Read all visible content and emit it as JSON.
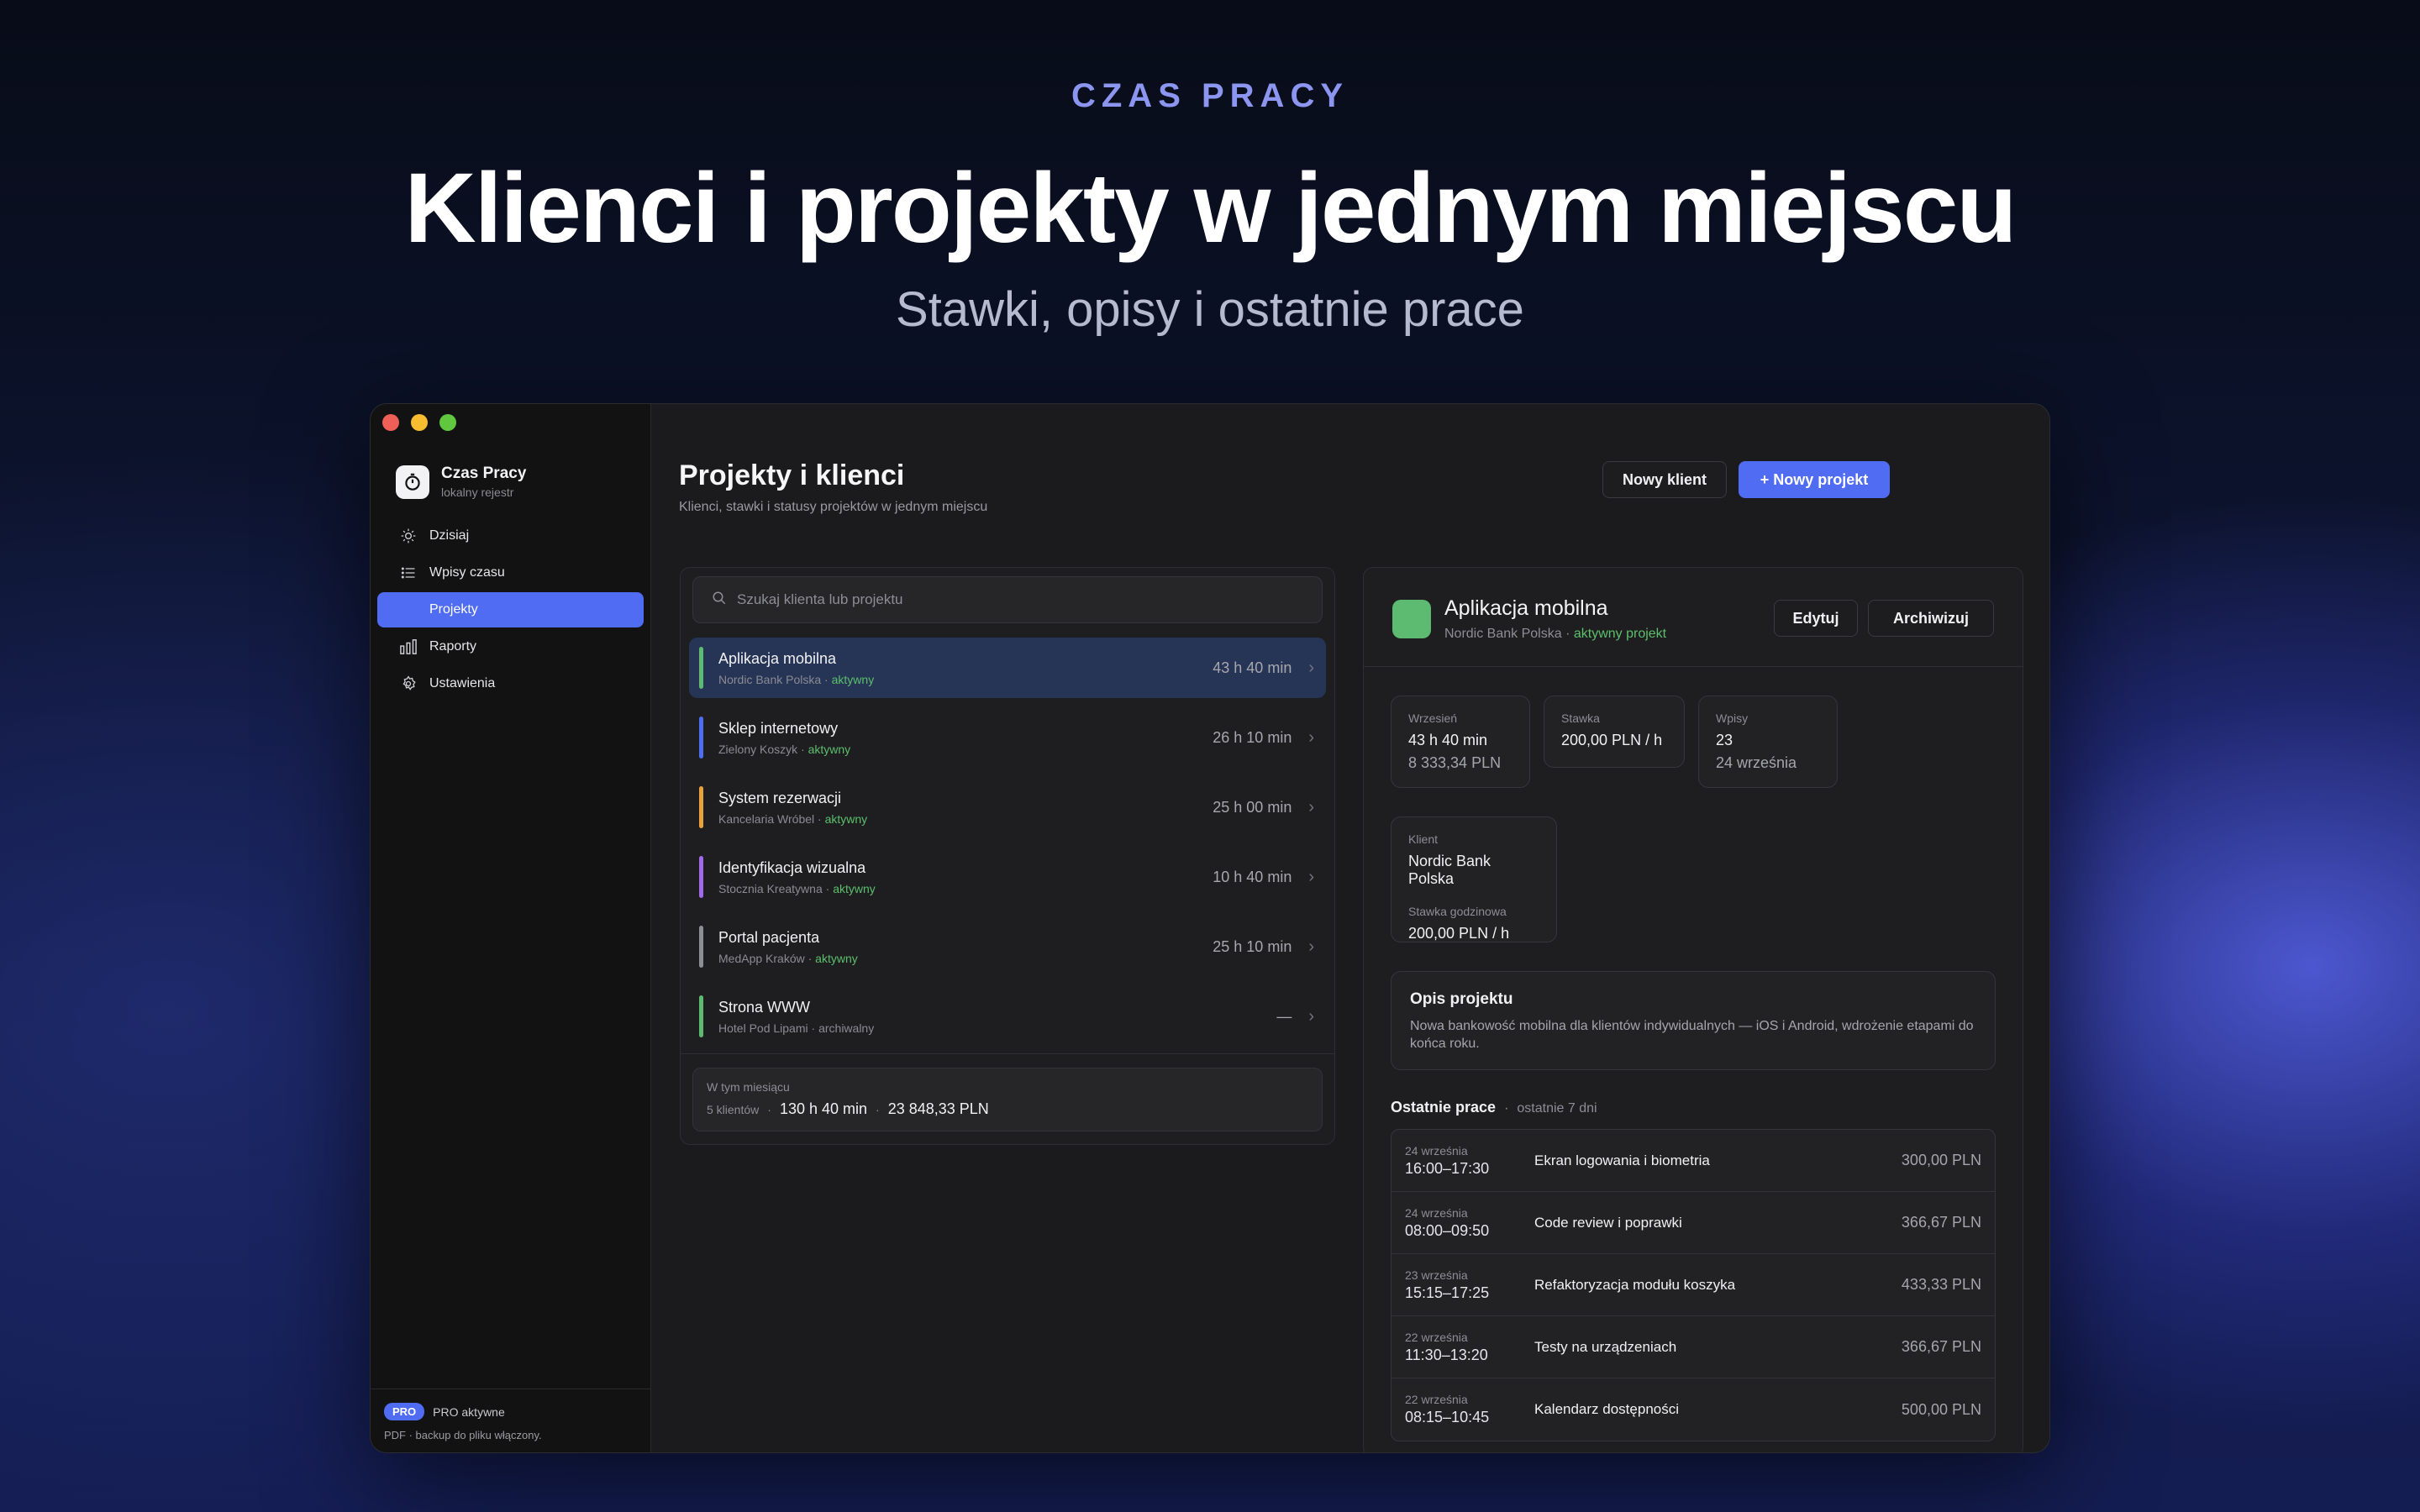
{
  "hero": {
    "eyebrow": "CZAS PRACY",
    "headline": "Klienci i projekty w jednym miejscu",
    "subhead": "Stawki, opisy i ostatnie prace"
  },
  "sidebar": {
    "brand_title": "Czas Pracy",
    "brand_sub": "lokalny rejestr",
    "items": [
      {
        "label": "Dzisiaj",
        "icon": "sun-icon"
      },
      {
        "label": "Wpisy czasu",
        "icon": "list-icon"
      },
      {
        "label": "Projekty",
        "icon": "folder-icon",
        "active": true
      },
      {
        "label": "Raporty",
        "icon": "bar-chart-icon"
      },
      {
        "label": "Ustawienia",
        "icon": "gear-icon"
      }
    ],
    "pro_badge": "PRO",
    "pro_label": "PRO aktywne",
    "pro_note": "PDF · backup do pliku włączony."
  },
  "header": {
    "title": "Projekty i klienci",
    "subtitle": "Klienci, stawki i statusy projektów w jednym miejscu",
    "new_client": "Nowy klient",
    "new_project": "+ Nowy projekt"
  },
  "search": {
    "placeholder": "Szukaj klienta lub projektu"
  },
  "projects": [
    {
      "name": "Aplikacja mobilna",
      "client": "Nordic Bank Polska",
      "status": "aktywny",
      "hours": "43 h 40 min",
      "color": "#5cbb70",
      "selected": true
    },
    {
      "name": "Sklep internetowy",
      "client": "Zielony Koszyk",
      "status": "aktywny",
      "hours": "26 h 10 min",
      "color": "#4f6cf2"
    },
    {
      "name": "System rezerwacji",
      "client": "Kancelaria Wróbel",
      "status": "aktywny",
      "hours": "25 h 00 min",
      "color": "#e8a23c"
    },
    {
      "name": "Identyfikacja wizualna",
      "client": "Stocznia Kreatywna",
      "status": "aktywny",
      "hours": "10 h 40 min",
      "color": "#a06ae8"
    },
    {
      "name": "Portal pacjenta",
      "client": "MedApp Kraków",
      "status": "aktywny",
      "hours": "25 h 10 min",
      "color": "#8e8e96"
    },
    {
      "name": "Strona WWW",
      "client": "Hotel Pod Lipami",
      "status": "archiwalny",
      "hours": "—",
      "color": "#5cbb70"
    }
  ],
  "summary": {
    "label": "W tym miesiącu",
    "clients": "5 klientów",
    "sep": "·",
    "hours": "130 h 40 min",
    "sep2": "·",
    "amount": "23 848,33 PLN"
  },
  "detail": {
    "title": "Aplikacja mobilna",
    "client": "Nordic Bank Polska",
    "status": "aktywny projekt",
    "edit": "Edytuj",
    "archive": "Archiwizuj",
    "month_label": "Wrzesień",
    "month_hours": "43 h 40 min",
    "month_amount": "8 333,34 PLN",
    "rate_label": "Stawka",
    "rate_value": "200,00 PLN / h",
    "entries_label": "Wpisy",
    "entries_count": "23",
    "entries_last": "24 września",
    "client_label": "Klient",
    "client_value": "Nordic Bank Polska",
    "hourly_label": "Stawka godzinowa",
    "hourly_value": "200,00 PLN / h",
    "desc_title": "Opis projektu",
    "desc_text": "Nowa bankowość mobilna dla klientów indywidualnych — iOS i Android, wdrożenie etapami do końca roku.",
    "recent_title": "Ostatnie prace",
    "recent_sep": "·",
    "recent_range": "ostatnie 7 dni",
    "recent": [
      {
        "date": "24 września",
        "time": "16:00–17:30",
        "task": "Ekran logowania i biometria",
        "amount": "300,00 PLN"
      },
      {
        "date": "24 września",
        "time": "08:00–09:50",
        "task": "Code review i poprawki",
        "amount": "366,67 PLN"
      },
      {
        "date": "23 września",
        "time": "15:15–17:25",
        "task": "Refaktoryzacja modułu koszyka",
        "amount": "433,33 PLN"
      },
      {
        "date": "22 września",
        "time": "11:30–13:20",
        "task": "Testy na urządzeniach",
        "amount": "366,67 PLN"
      },
      {
        "date": "22 września",
        "time": "08:15–10:45",
        "task": "Kalendarz dostępności",
        "amount": "500,00 PLN"
      }
    ]
  }
}
